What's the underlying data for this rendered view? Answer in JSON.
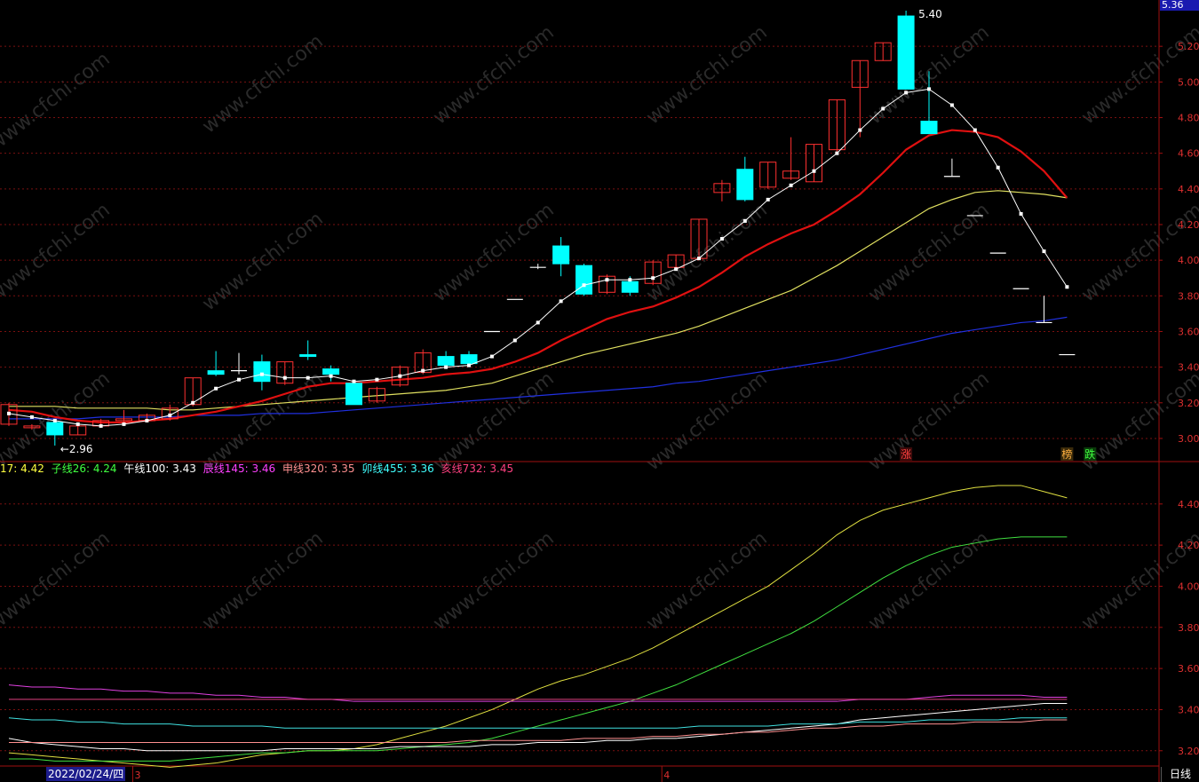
{
  "chart_data": {
    "type": "candlestick",
    "main": {
      "y_ticks": [
        "5.20",
        "5.00",
        "4.80",
        "4.60",
        "4.40",
        "4.20",
        "4.00",
        "3.80",
        "3.60",
        "3.40",
        "3.20",
        "3.00"
      ],
      "ylim": [
        2.94,
        5.42
      ],
      "last_price": "5.36",
      "high_label": "5.40",
      "low_label": "2.96",
      "candles": [
        {
          "o": 3.08,
          "h": 3.2,
          "l": 3.07,
          "c": 3.19
        },
        {
          "o": 3.06,
          "h": 3.08,
          "l": 3.05,
          "c": 3.07
        },
        {
          "o": 3.09,
          "h": 3.1,
          "l": 2.96,
          "c": 3.02
        },
        {
          "o": 3.02,
          "h": 3.08,
          "l": 3.02,
          "c": 3.07
        },
        {
          "o": 3.07,
          "h": 3.11,
          "l": 3.06,
          "c": 3.1
        },
        {
          "o": 3.1,
          "h": 3.16,
          "l": 3.09,
          "c": 3.11
        },
        {
          "o": 3.1,
          "h": 3.14,
          "l": 3.09,
          "c": 3.13
        },
        {
          "o": 3.11,
          "h": 3.19,
          "l": 3.1,
          "c": 3.17
        },
        {
          "o": 3.19,
          "h": 3.34,
          "l": 3.18,
          "c": 3.34
        },
        {
          "o": 3.38,
          "h": 3.49,
          "l": 3.35,
          "c": 3.36
        },
        {
          "o": 3.38,
          "h": 3.48,
          "l": 3.36,
          "c": 3.38
        },
        {
          "o": 3.43,
          "h": 3.47,
          "l": 3.27,
          "c": 3.32
        },
        {
          "o": 3.31,
          "h": 3.43,
          "l": 3.3,
          "c": 3.43
        },
        {
          "o": 3.47,
          "h": 3.55,
          "l": 3.44,
          "c": 3.46
        },
        {
          "o": 3.39,
          "h": 3.41,
          "l": 3.32,
          "c": 3.36
        },
        {
          "o": 3.31,
          "h": 3.32,
          "l": 3.19,
          "c": 3.19
        },
        {
          "o": 3.21,
          "h": 3.29,
          "l": 3.2,
          "c": 3.28
        },
        {
          "o": 3.3,
          "h": 3.41,
          "l": 3.29,
          "c": 3.4
        },
        {
          "o": 3.37,
          "h": 3.5,
          "l": 3.36,
          "c": 3.48
        },
        {
          "o": 3.46,
          "h": 3.49,
          "l": 3.39,
          "c": 3.41
        },
        {
          "o": 3.47,
          "h": 3.49,
          "l": 3.41,
          "c": 3.42
        },
        {
          "o": 3.6,
          "h": 3.6,
          "l": 3.6,
          "c": 3.6
        },
        {
          "o": 3.78,
          "h": 3.78,
          "l": 3.78,
          "c": 3.78
        },
        {
          "o": 3.96,
          "h": 3.98,
          "l": 3.95,
          "c": 3.96
        },
        {
          "o": 4.08,
          "h": 4.13,
          "l": 3.91,
          "c": 3.98
        },
        {
          "o": 3.97,
          "h": 3.98,
          "l": 3.8,
          "c": 3.81
        },
        {
          "o": 3.82,
          "h": 3.92,
          "l": 3.81,
          "c": 3.91
        },
        {
          "o": 3.88,
          "h": 3.91,
          "l": 3.8,
          "c": 3.82
        },
        {
          "o": 3.87,
          "h": 4.0,
          "l": 3.86,
          "c": 3.99
        },
        {
          "o": 3.96,
          "h": 4.03,
          "l": 3.95,
          "c": 4.03
        },
        {
          "o": 4.01,
          "h": 4.23,
          "l": 4.0,
          "c": 4.23
        },
        {
          "o": 4.38,
          "h": 4.45,
          "l": 4.33,
          "c": 4.43
        },
        {
          "o": 4.51,
          "h": 4.58,
          "l": 4.33,
          "c": 4.34
        },
        {
          "o": 4.41,
          "h": 4.55,
          "l": 4.4,
          "c": 4.55
        },
        {
          "o": 4.46,
          "h": 4.69,
          "l": 4.45,
          "c": 4.5
        },
        {
          "o": 4.44,
          "h": 4.65,
          "l": 4.44,
          "c": 4.65
        },
        {
          "o": 4.62,
          "h": 4.9,
          "l": 4.6,
          "c": 4.9
        },
        {
          "o": 4.97,
          "h": 5.12,
          "l": 4.69,
          "c": 5.12
        },
        {
          "o": 5.12,
          "h": 5.22,
          "l": 5.12,
          "c": 5.22
        },
        {
          "o": 5.37,
          "h": 5.4,
          "l": 4.96,
          "c": 4.96
        },
        {
          "o": 4.78,
          "h": 5.06,
          "l": 4.72,
          "c": 4.71
        },
        {
          "o": 4.47,
          "h": 4.57,
          "l": 4.47,
          "c": 4.47
        },
        {
          "o": 4.25,
          "h": 4.25,
          "l": 4.25,
          "c": 4.25
        },
        {
          "o": 4.04,
          "h": 4.04,
          "l": 4.04,
          "c": 4.04
        },
        {
          "o": 3.84,
          "h": 3.84,
          "l": 3.84,
          "c": 3.84
        },
        {
          "o": 3.65,
          "h": 3.8,
          "l": 3.65,
          "c": 3.65
        },
        {
          "o": 3.47,
          "h": 3.47,
          "l": 3.47,
          "c": 3.47
        }
      ],
      "ma_white": [
        3.14,
        3.12,
        3.1,
        3.08,
        3.07,
        3.08,
        3.1,
        3.13,
        3.2,
        3.28,
        3.33,
        3.36,
        3.34,
        3.34,
        3.35,
        3.32,
        3.33,
        3.35,
        3.38,
        3.4,
        3.41,
        3.46,
        3.55,
        3.65,
        3.77,
        3.86,
        3.89,
        3.89,
        3.9,
        3.95,
        4.01,
        4.12,
        4.22,
        4.34,
        4.42,
        4.5,
        4.6,
        4.73,
        4.85,
        4.94,
        4.96,
        4.87,
        4.73,
        4.52,
        4.26,
        4.05,
        3.85
      ],
      "ma_red": [
        3.16,
        3.15,
        3.12,
        3.1,
        3.09,
        3.09,
        3.1,
        3.11,
        3.13,
        3.15,
        3.18,
        3.21,
        3.25,
        3.29,
        3.31,
        3.31,
        3.32,
        3.33,
        3.34,
        3.36,
        3.37,
        3.39,
        3.43,
        3.48,
        3.55,
        3.61,
        3.67,
        3.71,
        3.74,
        3.79,
        3.85,
        3.93,
        4.02,
        4.09,
        4.15,
        4.2,
        4.28,
        4.37,
        4.49,
        4.62,
        4.7,
        4.73,
        4.72,
        4.69,
        4.61,
        4.5,
        4.35
      ],
      "ma_yellow": [
        3.18,
        3.18,
        3.18,
        3.17,
        3.17,
        3.17,
        3.17,
        3.16,
        3.16,
        3.17,
        3.18,
        3.19,
        3.2,
        3.21,
        3.22,
        3.23,
        3.24,
        3.25,
        3.26,
        3.27,
        3.29,
        3.31,
        3.35,
        3.39,
        3.43,
        3.47,
        3.5,
        3.53,
        3.56,
        3.59,
        3.63,
        3.68,
        3.73,
        3.78,
        3.83,
        3.9,
        3.97,
        4.05,
        4.13,
        4.21,
        4.29,
        4.34,
        4.38,
        4.39,
        4.38,
        4.37,
        4.35
      ],
      "ma_blue": [
        3.11,
        3.11,
        3.11,
        3.11,
        3.12,
        3.12,
        3.12,
        3.12,
        3.13,
        3.13,
        3.13,
        3.14,
        3.14,
        3.14,
        3.15,
        3.16,
        3.17,
        3.18,
        3.19,
        3.2,
        3.21,
        3.22,
        3.23,
        3.24,
        3.25,
        3.26,
        3.27,
        3.28,
        3.29,
        3.31,
        3.32,
        3.34,
        3.36,
        3.38,
        3.4,
        3.42,
        3.44,
        3.47,
        3.5,
        3.53,
        3.56,
        3.59,
        3.61,
        3.63,
        3.65,
        3.66,
        3.68
      ],
      "markers": [
        {
          "label": "涨",
          "color": "#ff4040",
          "bg": "#3a0a0a",
          "index": 39
        },
        {
          "label": "榜",
          "color": "#ffb040",
          "bg": "#3a2a0a",
          "index": 46
        },
        {
          "label": "跌",
          "color": "#40ff40",
          "bg": "#0a3a0a",
          "index": 47
        }
      ]
    },
    "sub": {
      "y_ticks": [
        "4.40",
        "4.20",
        "4.00",
        "3.80",
        "3.60",
        "3.40",
        "3.20"
      ],
      "ylim": [
        3.13,
        4.52
      ],
      "legend": [
        {
          "label": "17: 4.42",
          "color": "#ffff40"
        },
        {
          "label": "子线26: 4.24",
          "color": "#40ff40"
        },
        {
          "label": "午线100: 3.43",
          "color": "#ffffff"
        },
        {
          "label": "辰线145: 3.46",
          "color": "#ff40ff"
        },
        {
          "label": "申线320: 3.35",
          "color": "#ff9090"
        },
        {
          "label": "卯线455: 3.36",
          "color": "#40ffff"
        },
        {
          "label": "亥线732: 3.45",
          "color": "#ff4080"
        }
      ],
      "series": [
        {
          "color": "#e0e040",
          "values": [
            3.19,
            3.18,
            3.17,
            3.16,
            3.15,
            3.14,
            3.13,
            3.12,
            3.13,
            3.14,
            3.16,
            3.18,
            3.19,
            3.2,
            3.2,
            3.21,
            3.23,
            3.26,
            3.29,
            3.32,
            3.36,
            3.4,
            3.45,
            3.5,
            3.54,
            3.57,
            3.61,
            3.65,
            3.7,
            3.76,
            3.82,
            3.88,
            3.94,
            4.0,
            4.08,
            4.16,
            4.25,
            4.32,
            4.37,
            4.4,
            4.43,
            4.46,
            4.48,
            4.49,
            4.49,
            4.46,
            4.43
          ]
        },
        {
          "color": "#40e040",
          "values": [
            3.16,
            3.16,
            3.15,
            3.15,
            3.15,
            3.15,
            3.15,
            3.15,
            3.16,
            3.17,
            3.18,
            3.19,
            3.19,
            3.2,
            3.2,
            3.2,
            3.2,
            3.21,
            3.22,
            3.23,
            3.24,
            3.26,
            3.29,
            3.32,
            3.35,
            3.38,
            3.41,
            3.44,
            3.48,
            3.52,
            3.57,
            3.62,
            3.67,
            3.72,
            3.77,
            3.83,
            3.9,
            3.97,
            4.04,
            4.1,
            4.15,
            4.19,
            4.21,
            4.23,
            4.24,
            4.24,
            4.24
          ]
        },
        {
          "color": "#ffffff",
          "values": [
            3.26,
            3.24,
            3.23,
            3.22,
            3.21,
            3.21,
            3.2,
            3.2,
            3.2,
            3.2,
            3.2,
            3.2,
            3.21,
            3.21,
            3.21,
            3.21,
            3.21,
            3.22,
            3.22,
            3.22,
            3.22,
            3.23,
            3.23,
            3.24,
            3.24,
            3.24,
            3.25,
            3.25,
            3.26,
            3.26,
            3.27,
            3.28,
            3.29,
            3.3,
            3.31,
            3.32,
            3.33,
            3.35,
            3.36,
            3.37,
            3.38,
            3.39,
            3.4,
            3.41,
            3.42,
            3.43,
            3.43
          ]
        },
        {
          "color": "#e040e0",
          "values": [
            3.52,
            3.51,
            3.51,
            3.5,
            3.5,
            3.49,
            3.49,
            3.48,
            3.48,
            3.47,
            3.47,
            3.46,
            3.46,
            3.45,
            3.45,
            3.44,
            3.44,
            3.44,
            3.44,
            3.44,
            3.44,
            3.44,
            3.44,
            3.44,
            3.44,
            3.44,
            3.44,
            3.44,
            3.44,
            3.44,
            3.44,
            3.44,
            3.44,
            3.44,
            3.44,
            3.44,
            3.44,
            3.45,
            3.45,
            3.45,
            3.46,
            3.47,
            3.47,
            3.47,
            3.47,
            3.46,
            3.46
          ]
        },
        {
          "color": "#ff9090",
          "values": [
            3.24,
            3.24,
            3.24,
            3.24,
            3.24,
            3.24,
            3.24,
            3.24,
            3.24,
            3.24,
            3.24,
            3.24,
            3.24,
            3.24,
            3.24,
            3.24,
            3.24,
            3.24,
            3.24,
            3.24,
            3.25,
            3.25,
            3.25,
            3.25,
            3.25,
            3.26,
            3.26,
            3.26,
            3.27,
            3.27,
            3.28,
            3.28,
            3.29,
            3.29,
            3.3,
            3.31,
            3.31,
            3.32,
            3.32,
            3.33,
            3.33,
            3.33,
            3.34,
            3.34,
            3.34,
            3.35,
            3.35
          ]
        },
        {
          "color": "#40e0e0",
          "values": [
            3.36,
            3.35,
            3.35,
            3.34,
            3.34,
            3.33,
            3.33,
            3.33,
            3.32,
            3.32,
            3.32,
            3.32,
            3.31,
            3.31,
            3.31,
            3.31,
            3.31,
            3.31,
            3.31,
            3.31,
            3.31,
            3.31,
            3.31,
            3.31,
            3.31,
            3.31,
            3.31,
            3.31,
            3.31,
            3.31,
            3.32,
            3.32,
            3.32,
            3.32,
            3.33,
            3.33,
            3.33,
            3.34,
            3.34,
            3.34,
            3.35,
            3.35,
            3.35,
            3.35,
            3.36,
            3.36,
            3.36
          ]
        },
        {
          "color": "#e04080",
          "values": [
            3.45,
            3.45,
            3.45,
            3.45,
            3.45,
            3.45,
            3.45,
            3.45,
            3.45,
            3.45,
            3.45,
            3.45,
            3.45,
            3.45,
            3.45,
            3.45,
            3.45,
            3.45,
            3.45,
            3.45,
            3.45,
            3.45,
            3.45,
            3.45,
            3.45,
            3.45,
            3.45,
            3.45,
            3.45,
            3.45,
            3.45,
            3.45,
            3.45,
            3.45,
            3.45,
            3.45,
            3.45,
            3.45,
            3.45,
            3.45,
            3.45,
            3.45,
            3.45,
            3.45,
            3.45,
            3.45,
            3.45
          ]
        }
      ]
    },
    "x_labels": [
      {
        "label": "3",
        "index": 5
      },
      {
        "label": "4",
        "index": 28
      }
    ]
  },
  "ui": {
    "date_badge": "2022/02/24/四",
    "period": "日线",
    "watermark": "www.cfchi.com"
  }
}
